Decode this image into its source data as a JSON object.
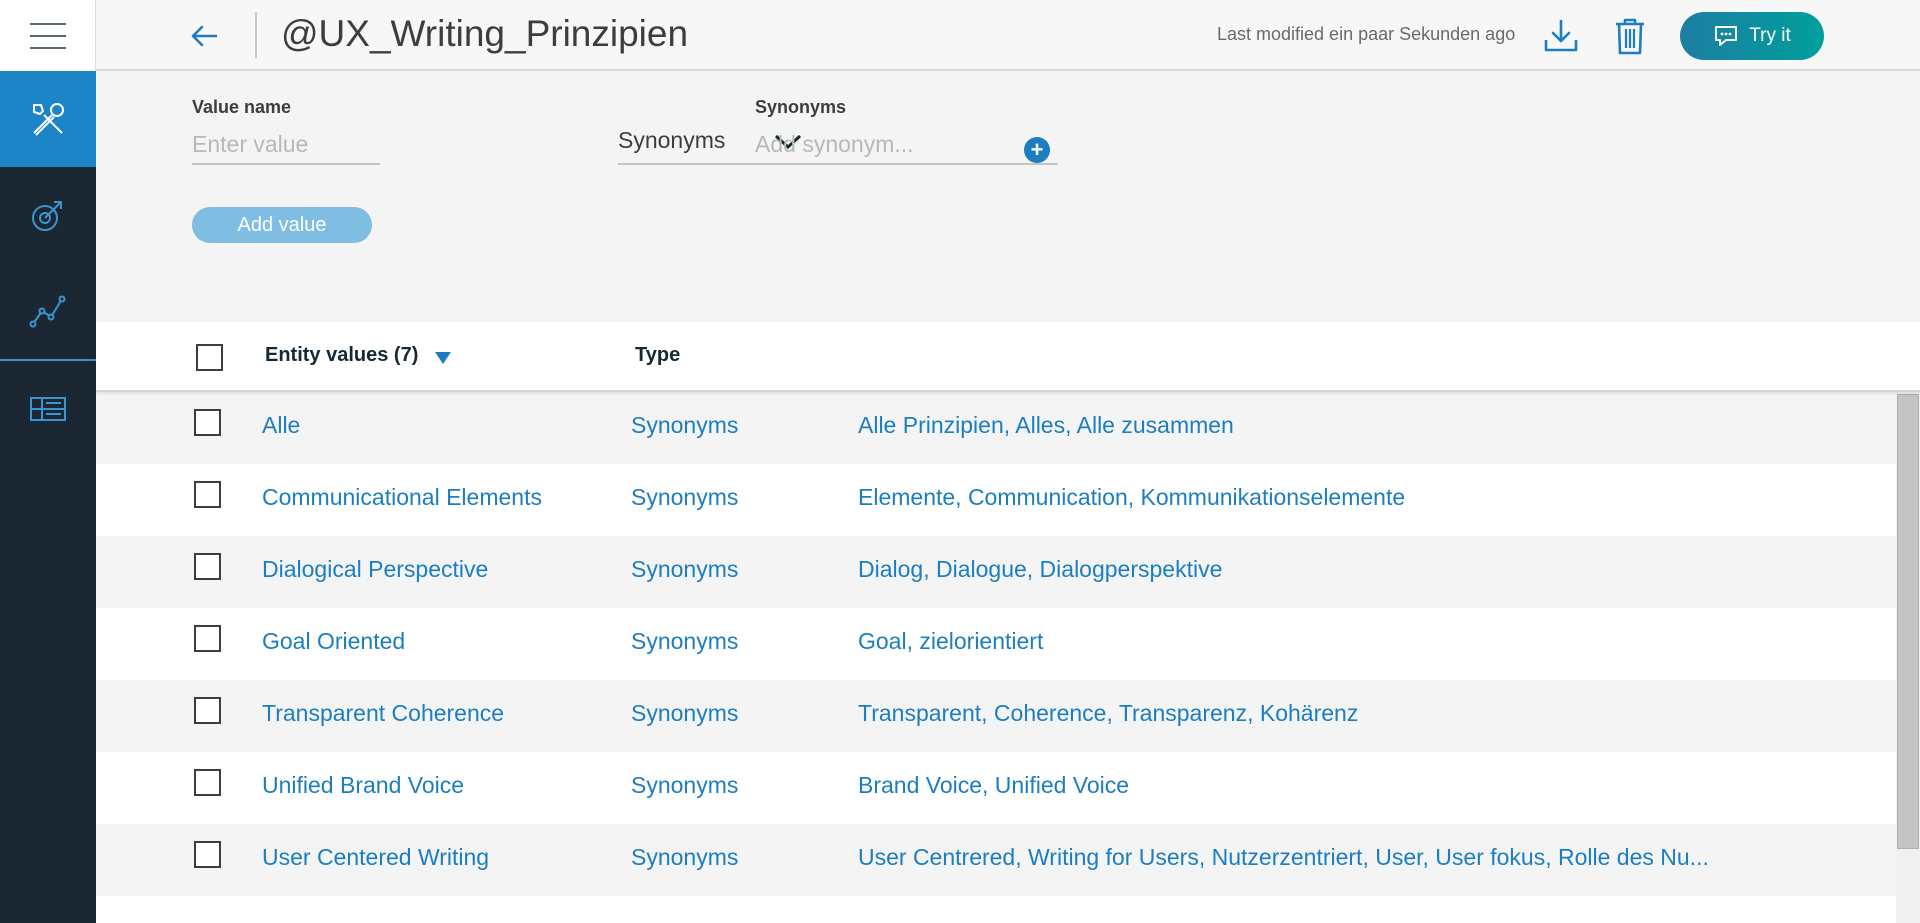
{
  "header": {
    "title": "@UX_Writing_Prinzipien",
    "last_modified": "Last modified ein paar Sekunden ago",
    "try_it_label": "Try it"
  },
  "sidebar": {
    "items": [
      {
        "icon": "tools-icon",
        "active": true
      },
      {
        "icon": "intent-target-icon",
        "active": false
      },
      {
        "icon": "analytics-graph-icon",
        "active": false
      },
      {
        "icon": "entity-table-icon",
        "active": false
      }
    ]
  },
  "form": {
    "value_name_label": "Value name",
    "value_name_placeholder": "Enter value",
    "type_selected": "Synonyms",
    "synonyms_label": "Synonyms",
    "synonyms_placeholder": "Add synonym...",
    "add_value_label": "Add value"
  },
  "table": {
    "header_values": "Entity values (7)",
    "header_type": "Type",
    "rows": [
      {
        "name": "Alle",
        "type": "Synonyms",
        "synonyms": "Alle Prinzipien, Alles, Alle zusammen"
      },
      {
        "name": "Communicational Elements",
        "type": "Synonyms",
        "synonyms": "Elemente, Communication, Kommunikationselemente"
      },
      {
        "name": "Dialogical Perspective",
        "type": "Synonyms",
        "synonyms": "Dialog, Dialogue, Dialogperspektive"
      },
      {
        "name": "Goal Oriented",
        "type": "Synonyms",
        "synonyms": "Goal, zielorientiert"
      },
      {
        "name": "Transparent Coherence",
        "type": "Synonyms",
        "synonyms": "Transparent, Coherence, Transparenz, Kohärenz"
      },
      {
        "name": "Unified Brand Voice",
        "type": "Synonyms",
        "synonyms": "Brand Voice, Unified Voice"
      },
      {
        "name": "User Centered Writing",
        "type": "Synonyms",
        "synonyms": "User Centrered, Writing for Users, Nutzerzentriert, User, User fokus, Rolle des Nu..."
      }
    ]
  },
  "colors": {
    "accent": "#1c7ec0",
    "sidebar_bg": "#1b2834",
    "sidebar_active": "#1c85c7"
  }
}
